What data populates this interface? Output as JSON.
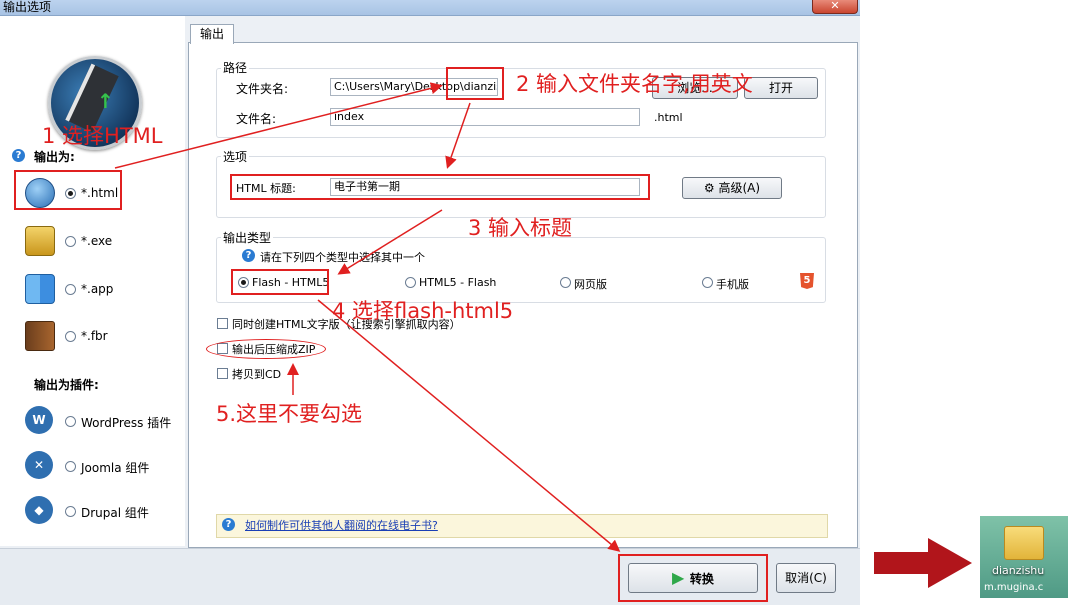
{
  "window": {
    "title": "输出选项",
    "close_label": "✕"
  },
  "left": {
    "output_as_label": "输出为:",
    "formats": [
      {
        "icon": "globe-icon",
        "label": "*.html",
        "selected": true
      },
      {
        "icon": "lock-icon",
        "label": "*.exe",
        "selected": false
      },
      {
        "icon": "finder-icon",
        "label": "*.app",
        "selected": false
      },
      {
        "icon": "book-icon",
        "label": "*.fbr",
        "selected": false
      }
    ],
    "plugins_label": "输出为插件:",
    "plugins": [
      {
        "icon": "wordpress-icon",
        "label": "WordPress 插件"
      },
      {
        "icon": "joomla-icon",
        "label": "Joomla 组件"
      },
      {
        "icon": "drupal-icon",
        "label": "Drupal 组件"
      }
    ]
  },
  "tab": {
    "label": "输出"
  },
  "path": {
    "group_label": "路径",
    "folder_label": "文件夹名:",
    "folder_value": "C:\\Users\\Mary\\Desktop\\dianzishu",
    "browse_label": "浏览...",
    "open_label": "打开",
    "filename_label": "文件名:",
    "filename_value": "index",
    "ext": ".html"
  },
  "options": {
    "group_label": "选项",
    "html_title_label": "HTML 标题:",
    "html_title_value": "电子书第一期",
    "advanced_label": "高级(A)"
  },
  "output_type": {
    "group_label": "输出类型",
    "hint": "请在下列四个类型中选择其中一个",
    "types": [
      {
        "label": "Flash - HTML5",
        "selected": true
      },
      {
        "label": "HTML5 - Flash",
        "selected": false
      },
      {
        "label": "网页版",
        "selected": false
      },
      {
        "label": "手机版",
        "selected": false
      }
    ]
  },
  "checks": [
    {
      "label": "同时创建HTML文字版（让搜索引擎抓取内容）",
      "checked": false
    },
    {
      "label": "输出后压缩成ZIP",
      "checked": false
    },
    {
      "label": "拷贝到CD",
      "checked": false
    }
  ],
  "help_link": "如何制作可供其他人翻阅的在线电子书?",
  "buttons": {
    "convert": "转换",
    "cancel": "取消(C)"
  },
  "annotations": {
    "step1": "1 选择HTML",
    "step2": "2 输入文件夹名字,用英文",
    "step3": "3 输入标题",
    "step4": "4 选择flash-html5",
    "step5": "5.这里不要勾选"
  },
  "desktop_icon": {
    "label": "dianzishu",
    "watermark": "m.mugina.c"
  },
  "colors": {
    "annotation": "#e02020",
    "arrow": "#b1151b"
  }
}
